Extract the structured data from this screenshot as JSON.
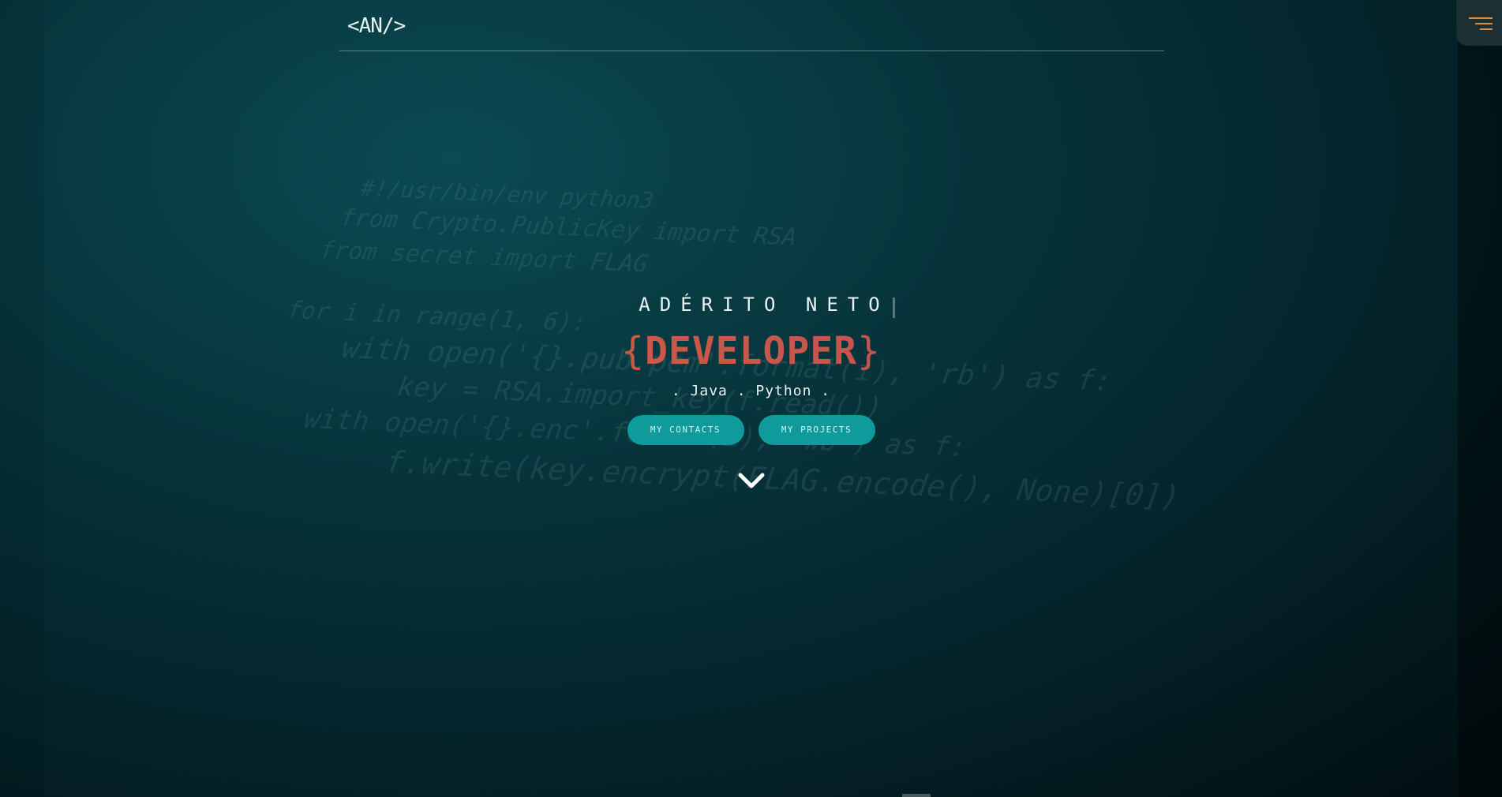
{
  "header": {
    "logo_text": "<AN/>"
  },
  "menu": {
    "icon": "hamburger-menu-icon",
    "accent_color": "#e08a3e"
  },
  "hero": {
    "name": "ADÉRITO NETO",
    "role_open": "{",
    "role": "DEVELOPER",
    "role_close": "}",
    "languages": ". Java . Python .",
    "buttons": {
      "contacts": "MY CONTACTS",
      "projects": "MY PROJECTS"
    },
    "scroll_icon": "chevron-down-icon"
  },
  "background_code": [
    "#!/usr/bin/env python3",
    "from Crypto.PublicKey import RSA",
    "from secret import FLAG",
    "",
    "for i in range(1, 6):",
    "    with open('{}.pub.pem'.format(i), 'rb') as f:",
    "        key = RSA.import_key(f.read())",
    "    with open('{}.enc'.format(i), 'wb') as f:",
    "        f.write(key.encrypt(FLAG.encode(), None)[0])"
  ],
  "colors": {
    "button_bg": "#0f9a9c",
    "role_gradient_start": "#e0603a",
    "role_gradient_end": "#b7466b"
  }
}
